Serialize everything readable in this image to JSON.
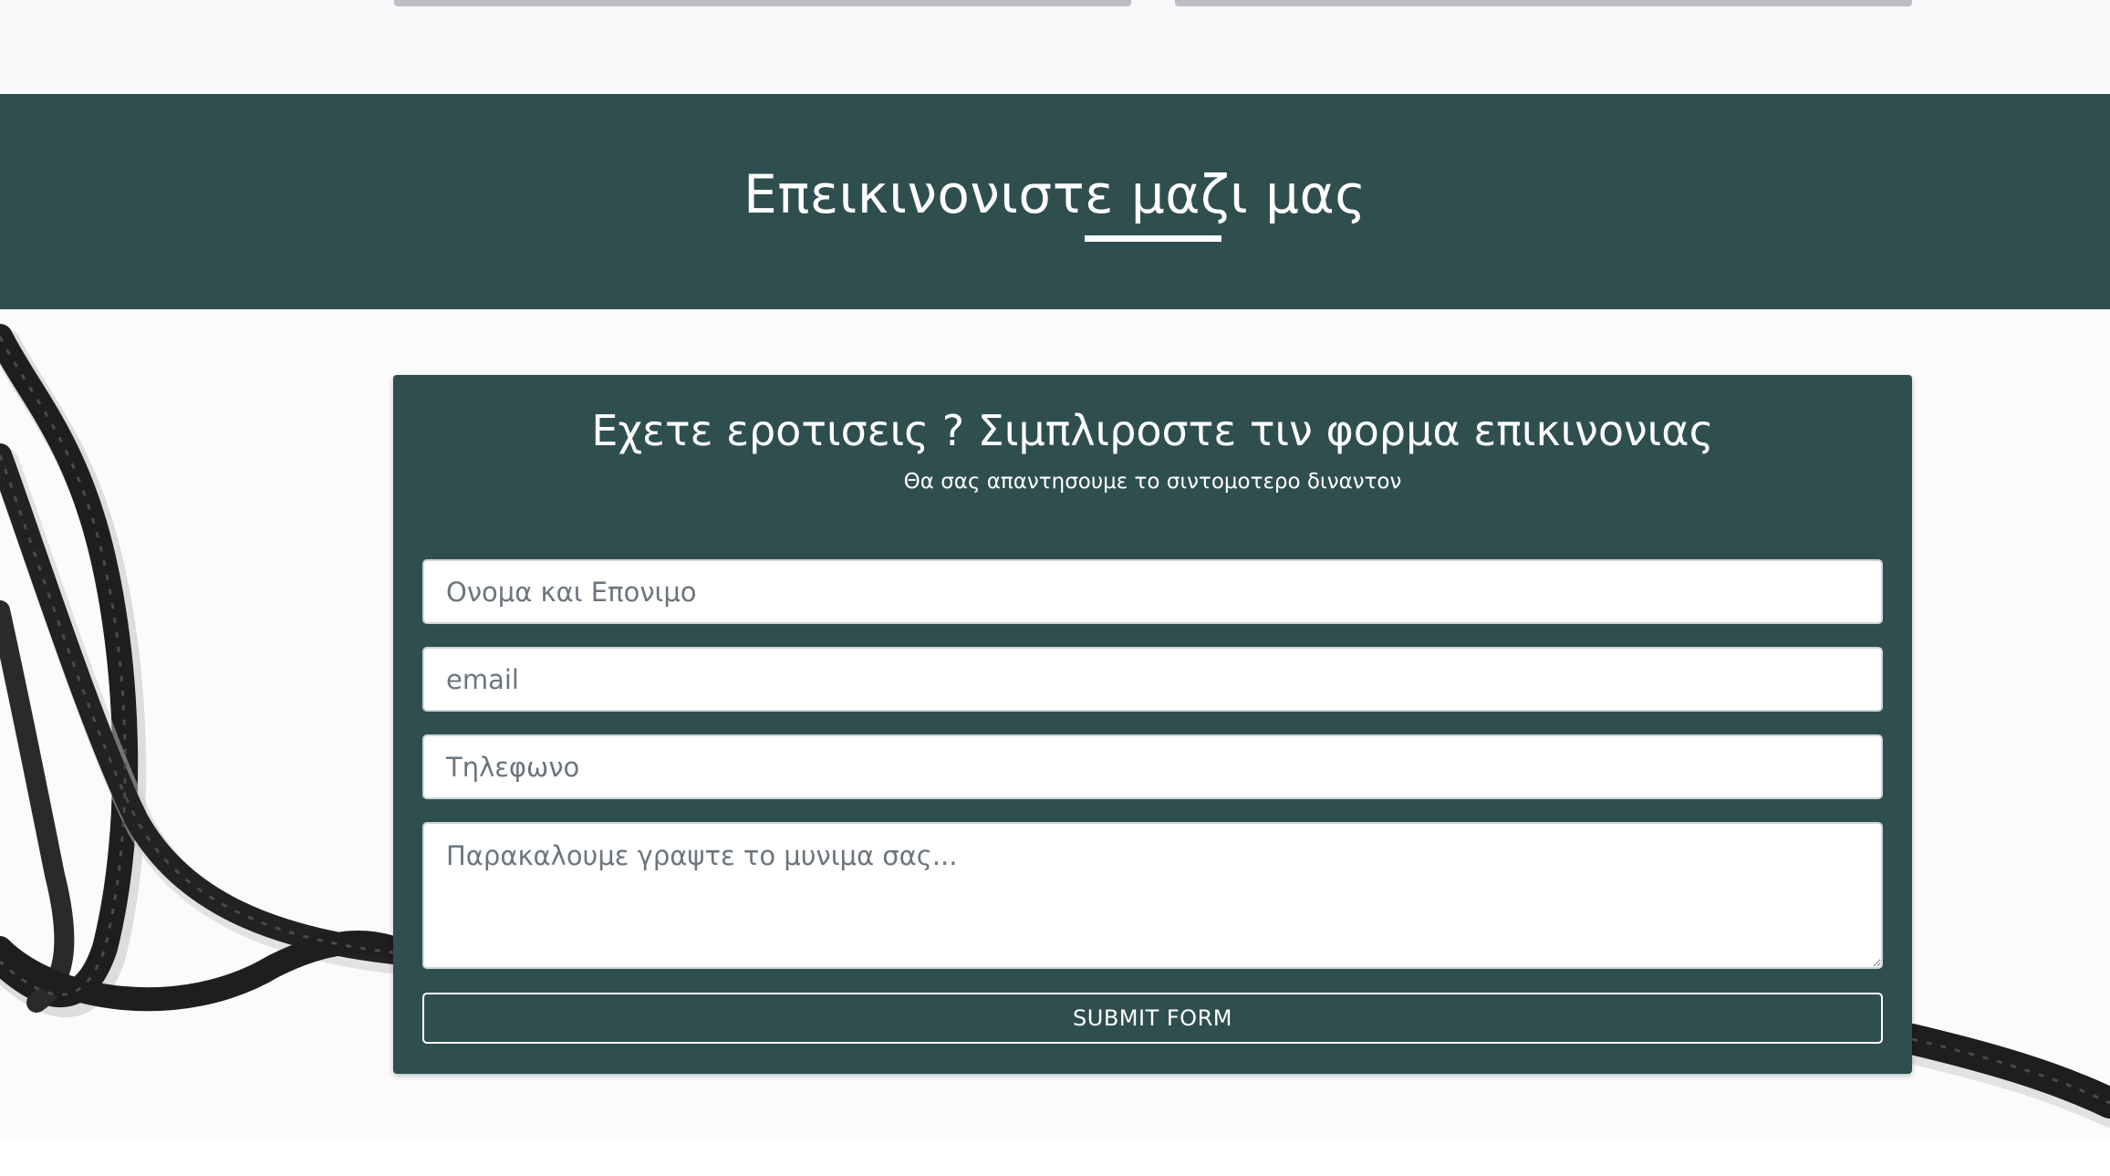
{
  "banner": {
    "title": "Επεικινονιστε μαζι μας"
  },
  "form": {
    "title": "Εχετε εροτισεις ? Σιμπλιροστε τιν φορμα επικινονιας",
    "subtitle": "Θα σας απαντησουμε το σιντομοτερο διναντον",
    "name_placeholder": "Ονομα και Επονιμο",
    "email_placeholder": "email",
    "phone_placeholder": "Τηλεφωνο",
    "message_placeholder": "Παρακαλουμε γραψτε το μυνιμα σας...",
    "submit_label": "SUBMIT FORM"
  },
  "colors": {
    "primary": "#2f4f4f",
    "text_on_primary": "#ffffff"
  }
}
